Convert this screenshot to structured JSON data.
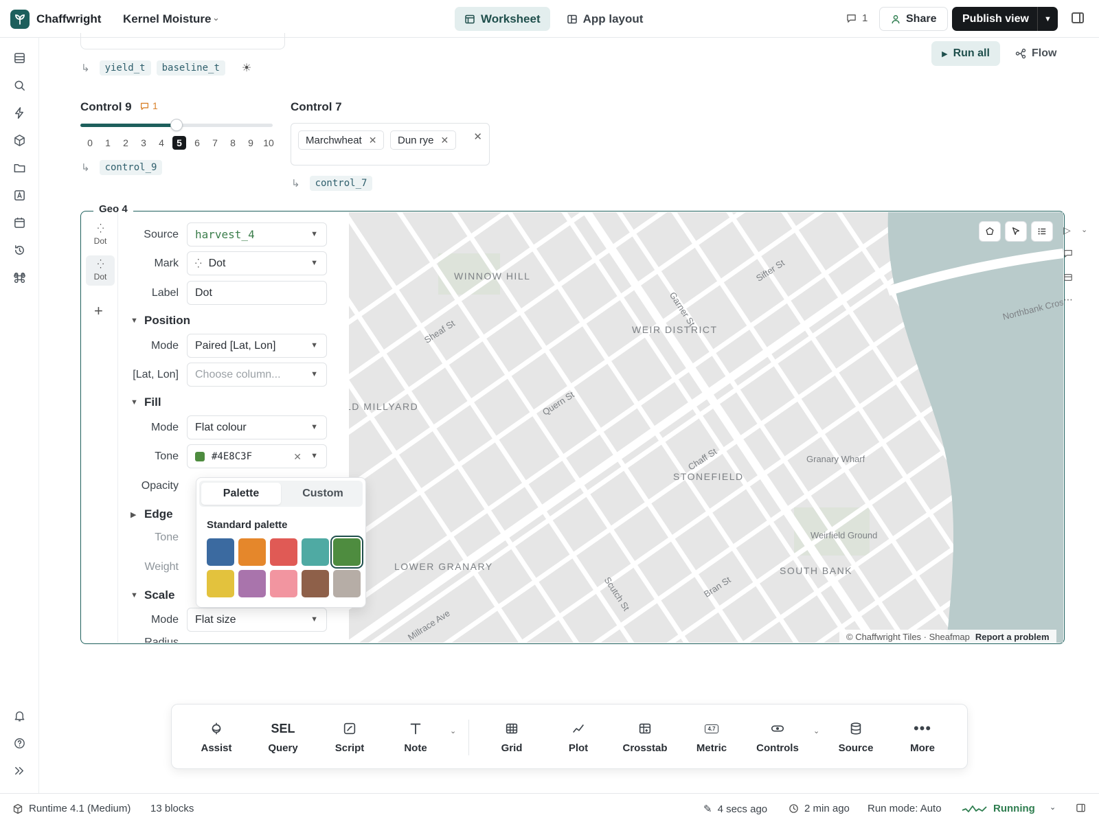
{
  "app": {
    "name": "Chaffwright",
    "project": "Kernel Moisture"
  },
  "header": {
    "tabs": [
      {
        "label": "Worksheet"
      },
      {
        "label": "App layout"
      }
    ],
    "comment_count": "1",
    "share_label": "Share",
    "publish_label": "Publish view"
  },
  "canvas": {
    "run_all_label": "Run all",
    "flow_label": "Flow"
  },
  "top_block": {
    "outputs": [
      "yield_t",
      "baseline_t"
    ]
  },
  "control9": {
    "title": "Control 9",
    "comment_count": "1",
    "ticks": [
      "0",
      "1",
      "2",
      "3",
      "4",
      "5",
      "6",
      "7",
      "8",
      "9",
      "10"
    ],
    "value": 5,
    "min": 0,
    "max": 10,
    "output": "control_9"
  },
  "control7": {
    "title": "Control 7",
    "tags": [
      "Marchwheat",
      "Dun rye"
    ],
    "output": "control_7"
  },
  "geo": {
    "title": "Geo 4",
    "layers": [
      {
        "label": "Dot"
      },
      {
        "label": "Dot"
      }
    ],
    "form": {
      "source_label": "Source",
      "source_value": "harvest_4",
      "mark_label": "Mark",
      "mark_value": "Dot",
      "label_label": "Label",
      "label_value": "Dot",
      "position_title": "Position",
      "pos_mode_label": "Mode",
      "pos_mode_value": "Paired [Lat, Lon]",
      "latlon_label": "[Lat, Lon]",
      "latlon_placeholder": "Choose column...",
      "fill_title": "Fill",
      "fill_mode_label": "Mode",
      "fill_mode_value": "Flat colour",
      "tone_label": "Tone",
      "tone_value": "#4E8C3F",
      "opacity_label": "Opacity",
      "edge_title": "Edge",
      "edge_tone_label": "Tone",
      "edge_weight_label": "Weight",
      "scale_title": "Scale",
      "scale_mode_label": "Mode",
      "scale_mode_value": "Flat size",
      "radius_label": "Radius"
    },
    "palette_popover": {
      "tabs": [
        "Palette",
        "Custom"
      ],
      "heading": "Standard palette",
      "swatches": [
        "#3B6AA0",
        "#E5872B",
        "#E05A55",
        "#4FAAA3",
        "#4E8C3F",
        "#E3C23D",
        "#A974AC",
        "#F295A0",
        "#8E6049",
        "#B6ADA6"
      ],
      "selected": "#4E8C3F"
    },
    "map": {
      "districts": [
        "WINNOW HILL",
        "WEIR DISTRICT",
        "LD MILLYARD",
        "STONEFIELD",
        "LOWER GRANARY",
        "SOUTH BANK"
      ],
      "streets": [
        "Sheaf St",
        "Sifter St",
        "Garner St",
        "Quern St",
        "Chaff St",
        "Scutch St",
        "Bran St",
        "Millrace Ave",
        "Northbank Cros"
      ],
      "places": [
        "Granary Wharf",
        "Weirfield Ground"
      ],
      "attribution": "© Chaffwright Tiles · Sheafmap",
      "report_label": "Report a problem"
    }
  },
  "dock": {
    "items": [
      {
        "label": "Assist",
        "icon": "assist-icon"
      },
      {
        "label": "Query",
        "icon": "SEL"
      },
      {
        "label": "Script",
        "icon": "script-icon"
      },
      {
        "label": "Note",
        "icon": "note-icon"
      },
      {
        "label": "Grid",
        "icon": "grid-icon"
      },
      {
        "label": "Plot",
        "icon": "plot-icon"
      },
      {
        "label": "Crosstab",
        "icon": "crosstab-icon"
      },
      {
        "label": "Metric",
        "icon": "metric-icon"
      },
      {
        "label": "Controls",
        "icon": "controls-icon"
      },
      {
        "label": "Source",
        "icon": "source-icon"
      },
      {
        "label": "More",
        "icon": "more-icon"
      }
    ],
    "metric_icon_text": "4.7"
  },
  "status": {
    "runtime": "Runtime 4.1 (Medium)",
    "blocks": "13 blocks",
    "edited": "4 secs ago",
    "ran": "2 min ago",
    "run_mode": "Run mode: Auto",
    "state": "Running"
  },
  "colors": {
    "accent": "#1d5f5c",
    "running": "#2e7d4f",
    "water": "#b9cbcb"
  }
}
